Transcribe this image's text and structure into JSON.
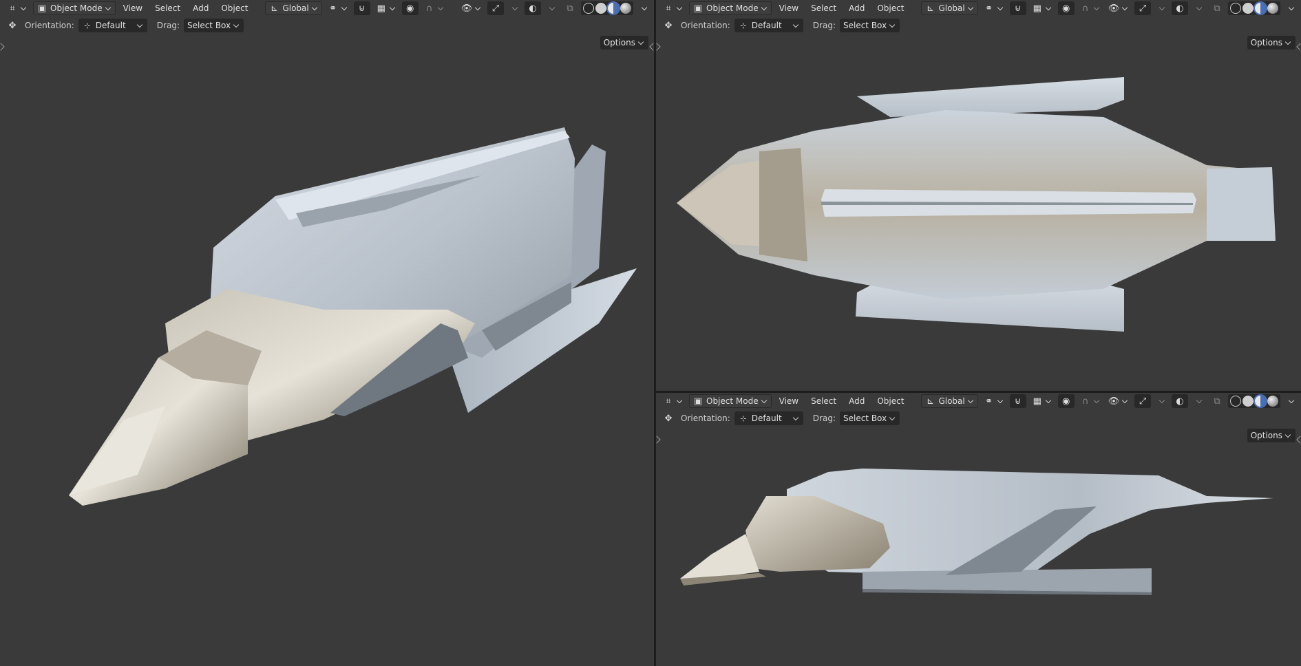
{
  "viewports": [
    {
      "id": "perspective",
      "mode": "Object Mode",
      "menus": [
        "View",
        "Select",
        "Add",
        "Object"
      ],
      "transform_orientation": "Global",
      "orientation_label": "Orientation:",
      "orientation_value": "Default",
      "drag_label": "Drag:",
      "drag_value": "Select Box",
      "options_label": "Options"
    },
    {
      "id": "top",
      "mode": "Object Mode",
      "menus": [
        "View",
        "Select",
        "Add",
        "Object"
      ],
      "transform_orientation": "Global",
      "orientation_label": "Orientation:",
      "orientation_value": "Default",
      "drag_label": "Drag:",
      "drag_value": "Select Box",
      "options_label": "Options"
    },
    {
      "id": "side",
      "mode": "Object Mode",
      "menus": [
        "View",
        "Select",
        "Add",
        "Object"
      ],
      "transform_orientation": "Global",
      "orientation_label": "Orientation:",
      "orientation_value": "Default",
      "drag_label": "Drag:",
      "drag_value": "Select Box",
      "options_label": "Options"
    }
  ],
  "icons": {
    "editor_type": "editor-type-icon",
    "mode": "object-mode-icon",
    "orientation": "transform-gizmo-icon",
    "pivot": "pivot-icon",
    "snap": "snap-magnet-icon",
    "proportional": "proportional-edit-icon",
    "visibility": "visibility-icon",
    "gizmo": "gizmo-icon",
    "overlay": "overlay-icon",
    "xray": "xray-icon",
    "shading_wire": "wireframe-shading-icon",
    "shading_solid": "solid-shading-icon",
    "shading_material": "material-shading-icon",
    "shading_rendered": "rendered-shading-icon"
  },
  "colors": {
    "viewport_bg": "#3a3a3a",
    "active_shading": "#4a6fb5",
    "model_light": "#c8d0d8",
    "model_warm": "#a89e8a"
  }
}
